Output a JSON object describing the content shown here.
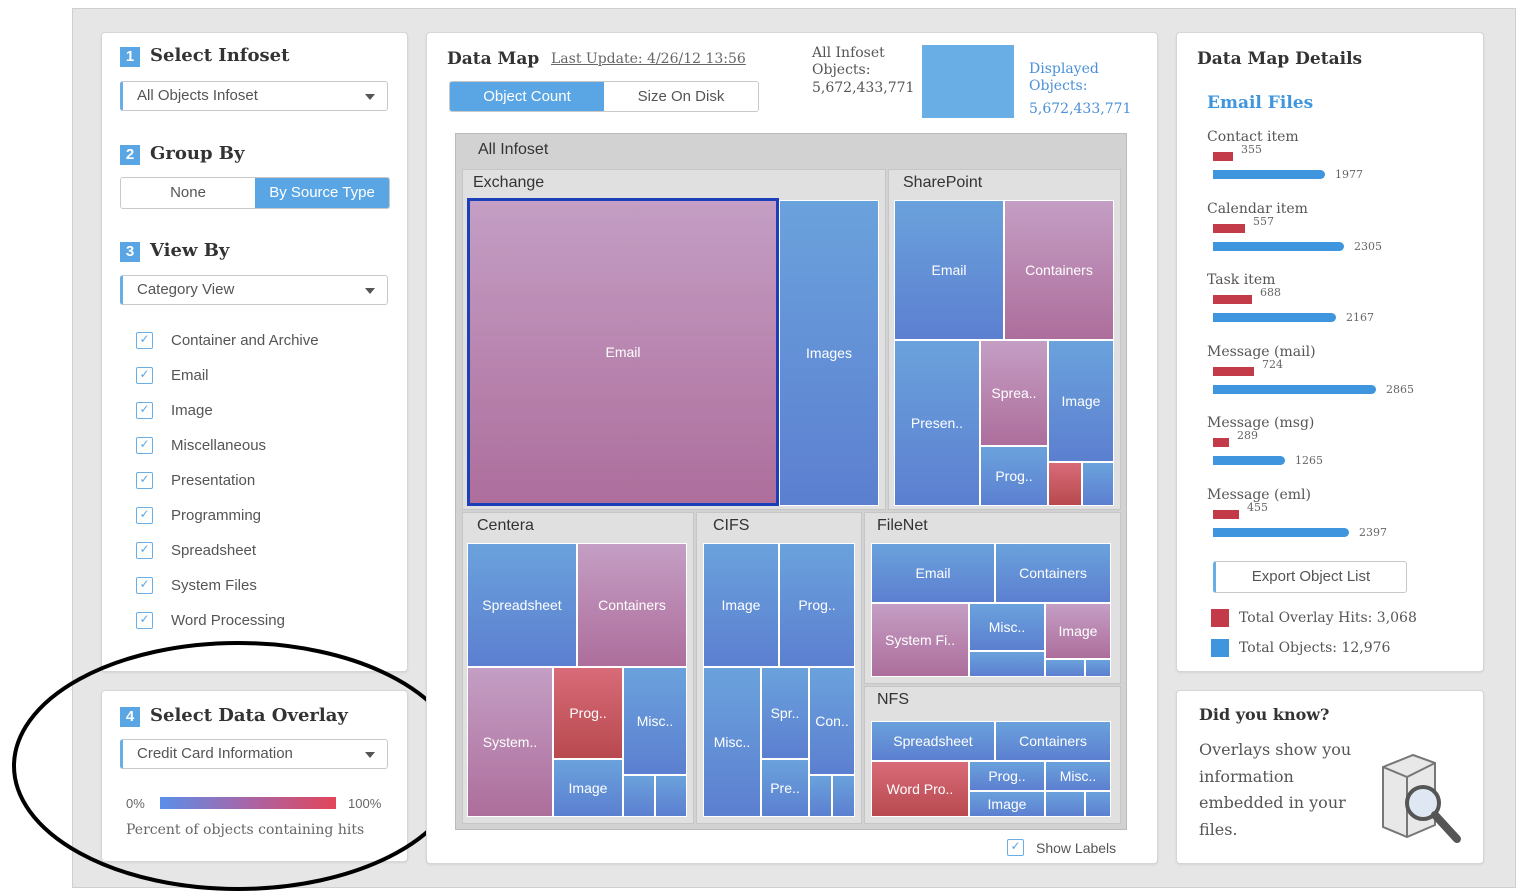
{
  "colors": {
    "accent": "#5aa6e4",
    "overlay_red": "#c33a48",
    "object_blue": "#3f95de"
  },
  "left": {
    "step1": {
      "num": "1",
      "title": "Select Infoset",
      "dropdown": "All Objects Infoset"
    },
    "step2": {
      "num": "2",
      "title": "Group By",
      "options": [
        "None",
        "By Source Type"
      ],
      "selected": "By Source Type"
    },
    "step3": {
      "num": "3",
      "title": "View By",
      "dropdown": "Category View",
      "categories": [
        "Container and Archive",
        "Email",
        "Image",
        "Miscellaneous",
        "Presentation",
        "Programming",
        "Spreadsheet",
        "System Files",
        "Word Processing"
      ]
    },
    "step4": {
      "num": "4",
      "title": "Select Data Overlay",
      "dropdown": "Credit Card Information",
      "scale_min": "0%",
      "scale_max": "100%",
      "scale_caption": "Percent of objects containing hits"
    }
  },
  "map": {
    "title": "Data Map",
    "last_update": "Last Update: 4/26/12 13:56",
    "tabs": [
      "Object Count",
      "Size On Disk"
    ],
    "all_objects_label": "All Infoset Objects:",
    "all_objects_value": "5,672,433,771",
    "displayed_label": "Displayed Objects:",
    "displayed_value": "5,672,433,771",
    "root_label": "All Infoset",
    "groups": {
      "exchange": "Exchange",
      "sharepoint": "SharePoint",
      "centera": "Centera",
      "cifs": "CIFS",
      "filenet": "FileNet",
      "nfs": "NFS"
    },
    "cells": {
      "ex_email": "Email",
      "ex_images": "Images",
      "sp_email": "Email",
      "sp_containers": "Containers",
      "sp_presen": "Presen..",
      "sp_sprea": "Sprea..",
      "sp_image": "Image",
      "sp_prog": "Prog..",
      "ce_spreadsheet": "Spreadsheet",
      "ce_containers": "Containers",
      "ce_system": "System..",
      "ce_prog": "Prog..",
      "ce_misc": "Misc..",
      "ce_image": "Image",
      "ci_image": "Image",
      "ci_prog": "Prog..",
      "ci_misc": "Misc..",
      "ci_spr": "Spr..",
      "ci_con": "Con..",
      "ci_pre": "Pre..",
      "fn_email": "Email",
      "fn_containers": "Containers",
      "fn_systemfi": "System Fi..",
      "fn_misc": "Misc..",
      "fn_image": "Image",
      "nfs_spreadsheet": "Spreadsheet",
      "nfs_containers": "Containers",
      "nfs_wordpro": "Word Pro..",
      "nfs_prog": "Prog..",
      "nfs_misc": "Misc..",
      "nfs_image": "Image"
    },
    "show_labels": "Show Labels"
  },
  "details": {
    "title": "Data Map Details",
    "subtitle": "Email Files",
    "items": [
      {
        "label": "Contact item",
        "hits": 355,
        "total": 1977
      },
      {
        "label": "Calendar item",
        "hits": 557,
        "total": 2305
      },
      {
        "label": "Task item",
        "hits": 688,
        "total": 2167
      },
      {
        "label": "Message (mail)",
        "hits": 724,
        "total": 2865
      },
      {
        "label": "Message (msg)",
        "hits": 289,
        "total": 1265
      },
      {
        "label": "Message (eml)",
        "hits": 455,
        "total": 2397
      }
    ],
    "items_text": [
      {
        "label": "Contact item",
        "hits": "355",
        "total": "1977"
      },
      {
        "label": "Calendar item",
        "hits": "557",
        "total": "2305"
      },
      {
        "label": "Task item",
        "hits": "688",
        "total": "2167"
      },
      {
        "label": "Message (mail)",
        "hits": "724",
        "total": "2865"
      },
      {
        "label": "Message (msg)",
        "hits": "289",
        "total": "1265"
      },
      {
        "label": "Message (eml)",
        "hits": "455",
        "total": "2397"
      }
    ],
    "export_button": "Export Object List",
    "legend_hits": "Total Overlay Hits: 3,068",
    "legend_objects": "Total Objects: 12,976"
  },
  "tip": {
    "title": "Did you know?",
    "text": "Overlays show you information embedded in your files."
  }
}
